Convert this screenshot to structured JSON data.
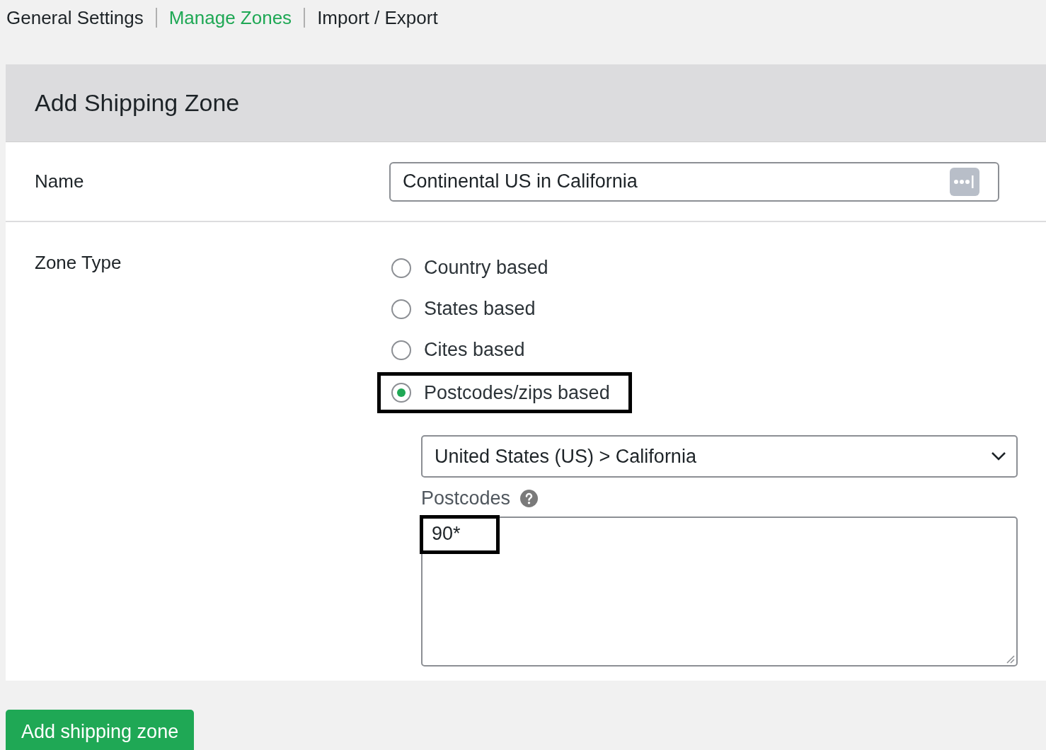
{
  "nav": [
    {
      "label": "General Settings",
      "selected": false
    },
    {
      "label": "Manage Zones",
      "selected": true
    },
    {
      "label": "Import / Export",
      "selected": false
    }
  ],
  "panel": {
    "title": "Add Shipping Zone",
    "name_field": {
      "label": "Name",
      "value": "Continental US in California"
    },
    "zone_type": {
      "label": "Zone Type",
      "options": [
        {
          "label": "Country based",
          "selected": false,
          "highlighted": false
        },
        {
          "label": "States based",
          "selected": false,
          "highlighted": false
        },
        {
          "label": "Cites based",
          "selected": false,
          "highlighted": false
        },
        {
          "label": "Postcodes/zips based",
          "selected": true,
          "highlighted": true
        }
      ]
    },
    "region_select": {
      "value": "United States (US) > California"
    },
    "postcodes": {
      "label": "Postcodes",
      "value": "90*",
      "highlighted": true
    }
  },
  "submit_button": "Add shipping zone"
}
